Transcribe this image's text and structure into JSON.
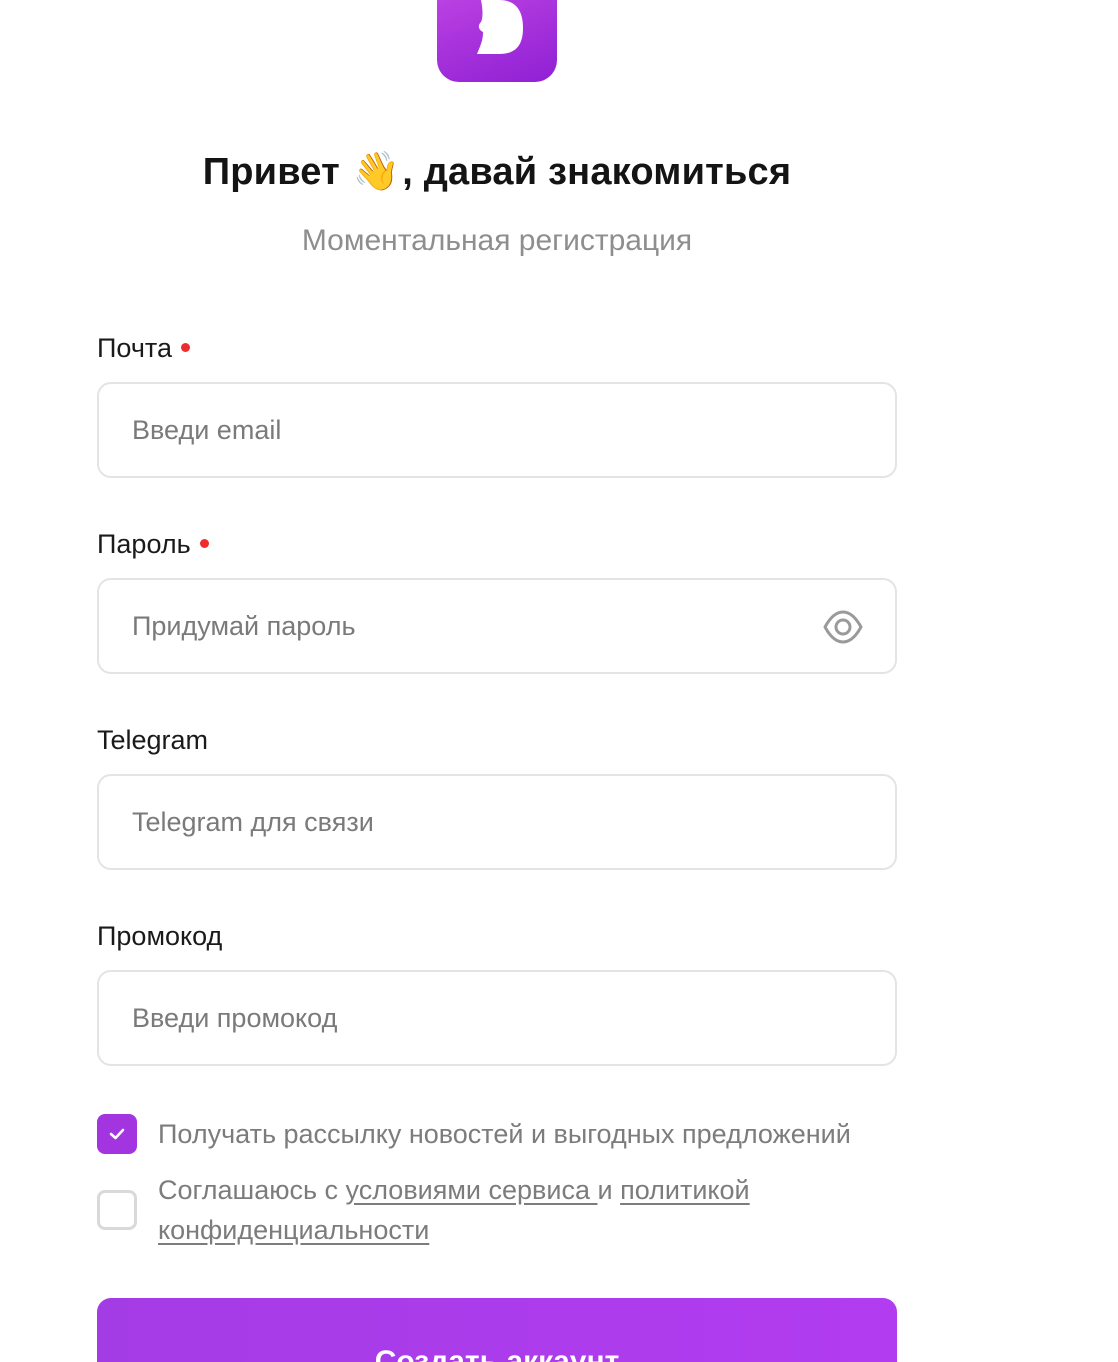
{
  "header": {
    "logo_icon": "brand-logo-icon",
    "title_part1": "Привет ",
    "title_emoji": "👋",
    "title_part2": ", давай знакомиться",
    "subtitle": "Моментальная регистрация"
  },
  "form": {
    "email": {
      "label": "Почта",
      "required": true,
      "placeholder": "Введи email"
    },
    "password": {
      "label": "Пароль",
      "required": true,
      "placeholder": "Придумай пароль",
      "toggle_icon": "eye-icon"
    },
    "telegram": {
      "label": "Telegram",
      "required": false,
      "placeholder": "Telegram для связи"
    },
    "promo": {
      "label": "Промокод",
      "required": false,
      "placeholder": "Введи промокод"
    }
  },
  "consents": {
    "newsletter": {
      "checked": true,
      "text": "Получать рассылку новостей и выгодных предложений"
    },
    "terms": {
      "checked": false,
      "text_before": "Соглашаюсь с ",
      "terms_link": "условиями сервиса ",
      "text_middle": "и ",
      "privacy_link_1": "политикой",
      "privacy_link_2": "конфиденциальности"
    }
  },
  "submit_label": "Создать аккаунт",
  "colors": {
    "accent": "#a335e0",
    "required_dot": "#ef2b2b",
    "muted_text": "#8e8e8e"
  }
}
